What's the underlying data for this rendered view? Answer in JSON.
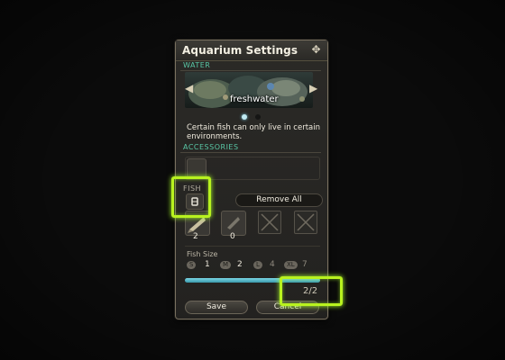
{
  "window": {
    "title": "Aquarium Settings",
    "close_icon": "gear-close-icon"
  },
  "water": {
    "section_label": "WATER",
    "environment": "freshwater",
    "pager_active": 1,
    "pager_total": 2,
    "description": "Certain fish can only live in certain environments."
  },
  "accessories": {
    "section_label": "ACCESSORIES"
  },
  "fish": {
    "section_label": "FISH",
    "remove_all_label": "Remove All",
    "slots": [
      {
        "count": "2",
        "state": "filled"
      },
      {
        "count": "0",
        "state": "filled"
      },
      {
        "count": "",
        "state": "empty"
      },
      {
        "count": "",
        "state": "empty"
      }
    ],
    "size_label": "Fish Size",
    "sizes": [
      {
        "tag": "S",
        "value": "1"
      },
      {
        "tag": "M",
        "value": "2"
      },
      {
        "tag": "L",
        "value": "4"
      },
      {
        "tag": "XL",
        "value": "7"
      }
    ],
    "capacity_fraction": 1.0,
    "capacity_text": "2/2"
  },
  "buttons": {
    "save_label": "Save",
    "cancel_label": "Cancel"
  },
  "colors": {
    "section_accent": "#59c7a5",
    "highlight": "#b8f21f",
    "progress": "#6cc9db"
  }
}
